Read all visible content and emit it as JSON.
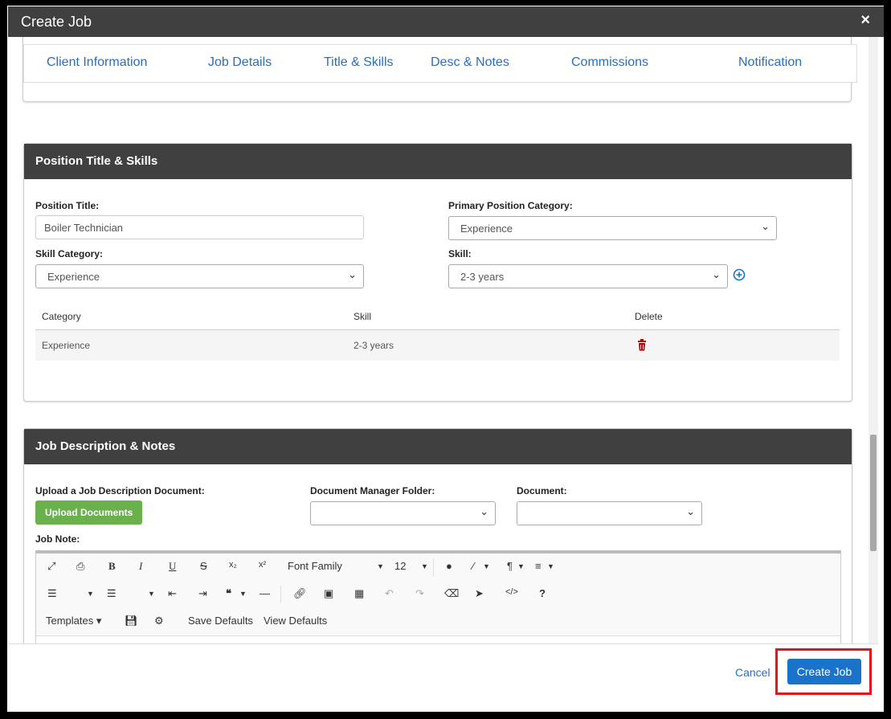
{
  "window": {
    "title": "Create Job",
    "close_glyph": "×"
  },
  "tabs": [
    "Client Information",
    "Job Details",
    "Title & Skills",
    "Desc & Notes",
    "Commissions",
    "Notification"
  ],
  "position_section": {
    "header": "Position Title & Skills",
    "position_title_label": "Position Title:",
    "position_title_value": "Boiler Technician",
    "primary_category_label": "Primary Position Category:",
    "primary_category_value": "Experience",
    "skill_category_label": "Skill Category:",
    "skill_category_value": "Experience",
    "skill_label": "Skill:",
    "skill_value": "2-3 years",
    "table_headers": [
      "Category",
      "Skill",
      "Delete"
    ],
    "table_rows": [
      {
        "category": "Experience",
        "skill": "2-3 years"
      }
    ]
  },
  "description_section": {
    "header": "Job Description & Notes",
    "upload_label": "Upload a Job Description Document:",
    "upload_button": "Upload Documents",
    "folder_label": "Document Manager Folder:",
    "document_label": "Document:",
    "job_note_label": "Job Note:",
    "editor": {
      "font_family": "Font Family",
      "font_size": "12",
      "templates": "Templates",
      "save_defaults": "Save Defaults",
      "view_defaults": "View Defaults"
    }
  },
  "footer": {
    "cancel": "Cancel",
    "create": "Create Job"
  },
  "colors": {
    "header_bg": "#404040",
    "link": "#2a6ebb",
    "primary": "#1a73c9",
    "upload": "#6ab04c",
    "highlight": "#e0161a"
  }
}
